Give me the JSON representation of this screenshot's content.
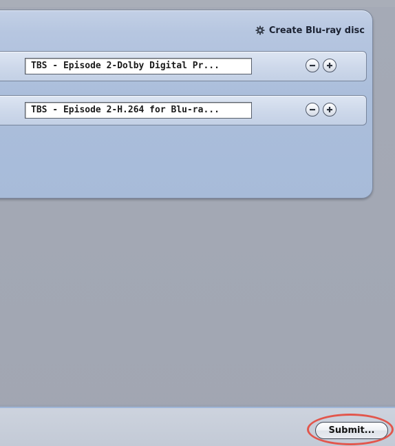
{
  "panel": {
    "create_label": "Create Blu-ray disc",
    "create_icon": "gear-icon",
    "targets": [
      {
        "preset": "TBS - Episode 2-Dolby Digital Pr...",
        "remove_icon": "minus-circle-icon",
        "add_icon": "plus-circle-icon"
      },
      {
        "preset": "TBS - Episode 2-H.264 for Blu-ra...",
        "remove_icon": "minus-circle-icon",
        "add_icon": "plus-circle-icon"
      }
    ]
  },
  "footer": {
    "submit_label": "Submit..."
  },
  "colors": {
    "panel_blue": "#abbedb",
    "window_gray": "#a3a8b4",
    "highlight_ring": "#e2564c"
  }
}
